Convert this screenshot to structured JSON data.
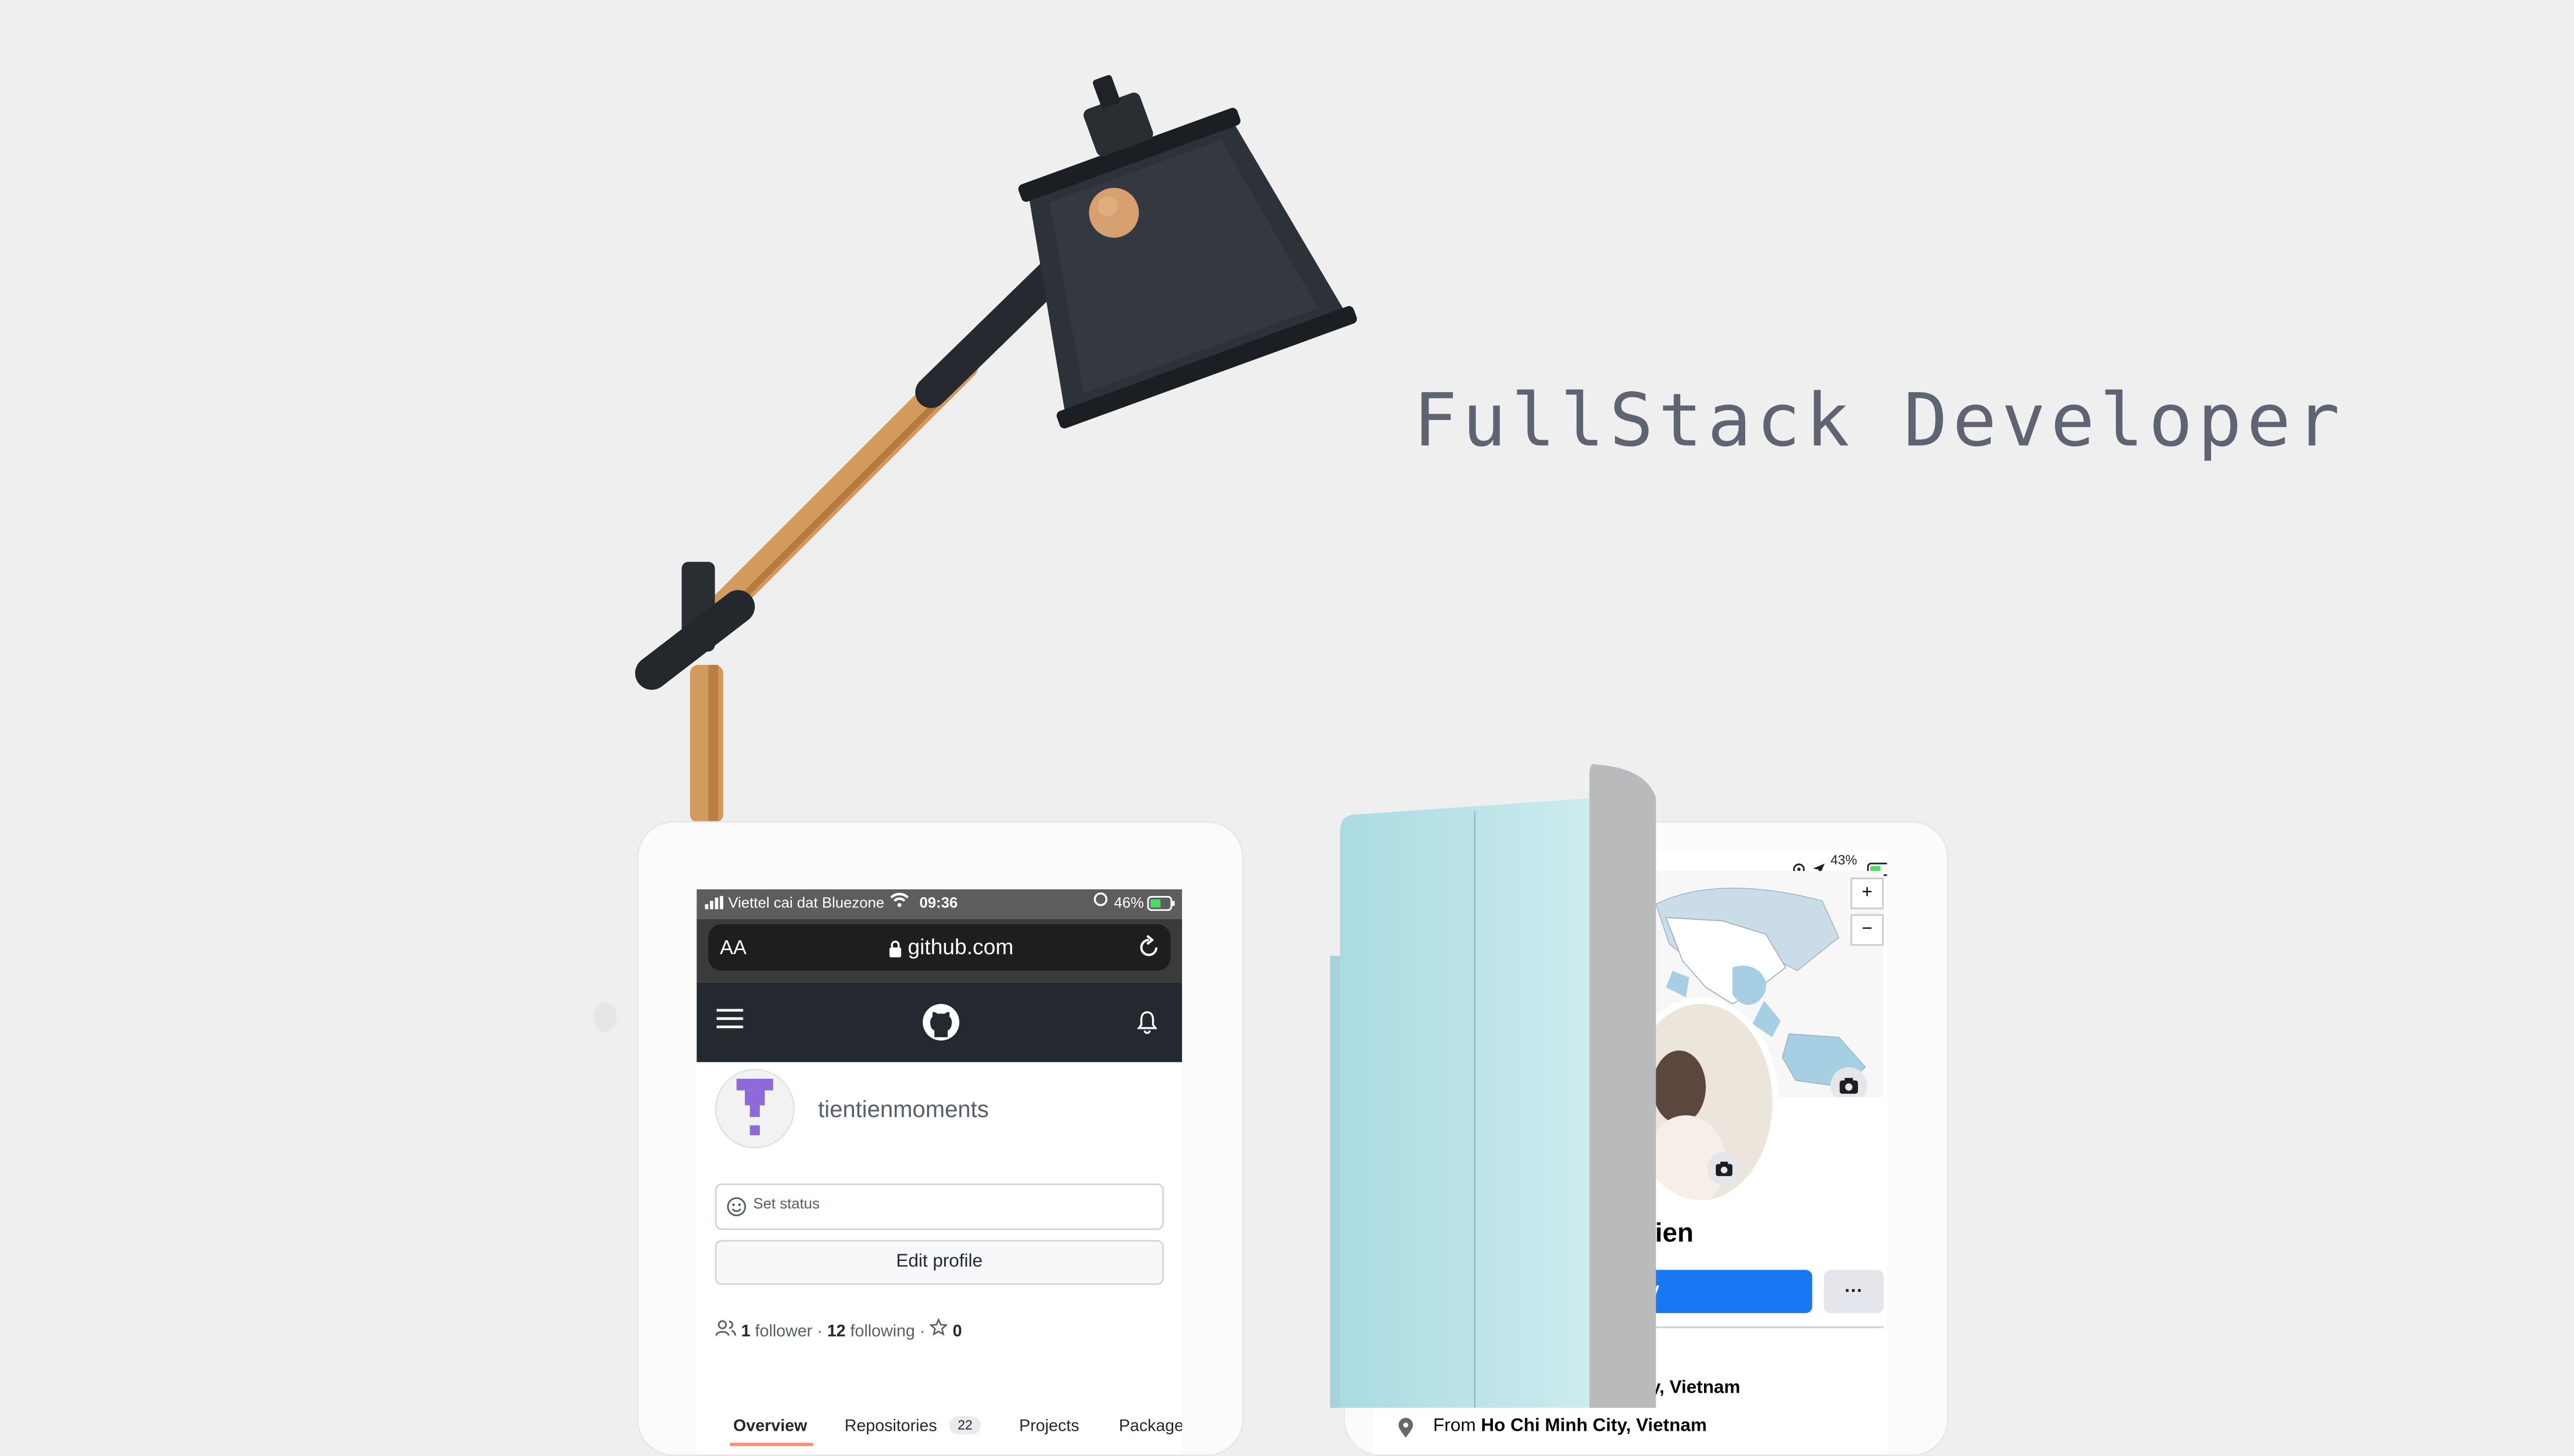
{
  "hero": {
    "title": "FullStack Developer"
  },
  "github_phone": {
    "status": {
      "carrier": "Viettel cai dat Bluezone",
      "time": "09:36",
      "battery": "46%"
    },
    "address_bar": {
      "text_size": "AA",
      "url": "github.com"
    },
    "nav": {
      "menu_icon": "hamburger-icon",
      "logo_icon": "github-logo-icon",
      "bell_icon": "bell-icon"
    },
    "profile": {
      "username": "tientienmoments",
      "set_status": "Set status",
      "edit_profile": "Edit profile"
    },
    "stats": {
      "followers_count": "1",
      "followers_label": "follower",
      "sep1": "·",
      "following_count": "12",
      "following_label": "following",
      "sep2": "·",
      "stars": "0"
    },
    "tabs": [
      {
        "label": "Overview"
      },
      {
        "label": "Repositories",
        "count": "22"
      },
      {
        "label": "Projects"
      },
      {
        "label": "Package"
      }
    ]
  },
  "facebook_phone": {
    "status": {
      "battery": "43%"
    },
    "map": {
      "zoom_in": "+",
      "zoom_out": "−"
    },
    "profile": {
      "name_fragment": "Tien",
      "button_fragment": "y",
      "more": "···"
    },
    "info": {
      "location_fragment": "ity, Vietnam",
      "from_label": "From",
      "from_value": "Ho Chi Minh City, Vietnam"
    }
  },
  "colors": {
    "background": "#efefef",
    "headline": "#5f6472",
    "github_dark": "#24292f",
    "facebook_blue": "#1877f2",
    "folder": "#bfe5ea"
  }
}
